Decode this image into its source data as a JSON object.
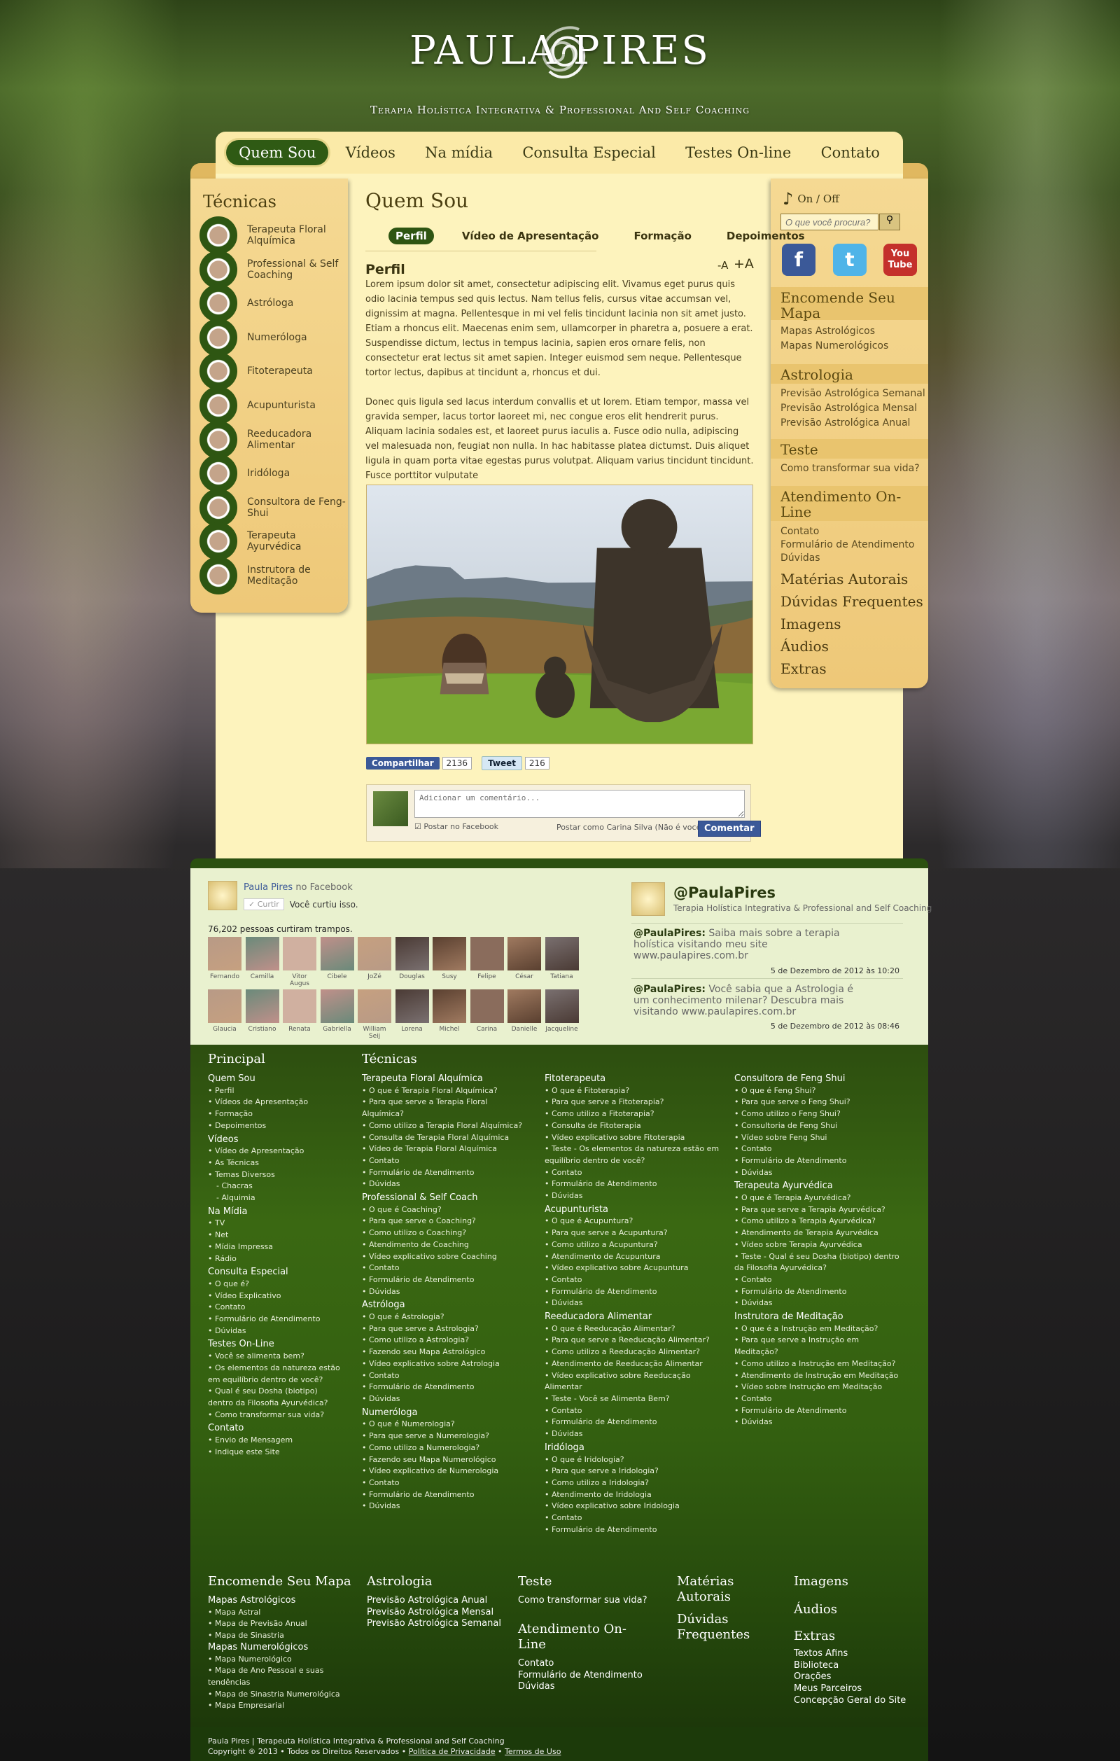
{
  "header": {
    "title": "PAULA PIRES",
    "tagline": "Terapia Holística Integrativa   &   Professional And Self Coaching"
  },
  "nav": [
    "Quem Sou",
    "Vídeos",
    "Na mídia",
    "Consulta Especial",
    "Testes On-line",
    "Contato"
  ],
  "left": {
    "title": "Técnicas",
    "items": [
      "Terapeuta Floral Alquímica",
      "Professional & Self Coaching",
      "Astróloga",
      "Numeróloga",
      "Fitoterapeuta",
      "Acupunturista",
      "Reeducadora Alimentar",
      "Iridóloga",
      "Consultora de Feng-Shui",
      "Terapeuta Ayurvédica",
      "Instrutora de Meditação"
    ]
  },
  "content": {
    "title": "Quem Sou",
    "tabs": [
      "Perfil",
      "Vídeo de Apresentação",
      "Formação",
      "Depoimentos"
    ],
    "heading": "Perfil",
    "font_minus": "-A",
    "font_plus": "+A",
    "p1": "Lorem ipsum dolor sit amet, consectetur adipiscing elit. Vivamus eget purus quis odio lacinia tempus sed quis lectus. Nam tellus felis, cursus vitae accumsan vel, dignissim at magna. Pellentesque in mi vel felis tincidunt lacinia non sit amet justo. Etiam a rhoncus elit. Maecenas enim sem, ullamcorper in pharetra a, posuere a erat. Suspendisse dictum, lectus in tempus lacinia, sapien eros ornare felis, non consectetur erat lectus sit amet sapien. Integer euismod sem neque. Pellentesque tortor lectus, dapibus at tincidunt a, rhoncus et dui.",
    "p2": "Donec quis ligula sed lacus interdum convallis et ut lorem. Etiam tempor, massa vel gravida semper, lacus tortor laoreet mi, nec congue eros elit hendrerit purus. Aliquam lacinia sodales est, et laoreet purus iaculis a. Fusce odio nulla, adipiscing vel malesuada non, feugiat non nulla. In hac habitasse platea dictumst. Duis aliquet ligula in quam porta vitae egestas purus volutpat. Aliquam varius tincidunt tincidunt. Fusce porttitor vulputate",
    "share": {
      "fb": "Compartilhar",
      "fb_count": "2136",
      "tw": "Tweet",
      "tw_count": "216"
    },
    "comment": {
      "placeholder": "Adicionar um comentário...",
      "post_fb": "Postar no Facebook",
      "post_as": "Postar como Carina Silva (Não é você?)",
      "button": "Comentar"
    }
  },
  "right": {
    "music": "On  /  Off",
    "search_placeholder": "O que você procura?",
    "social": [
      "f",
      "t",
      "You Tube"
    ],
    "s1": "Encomende Seu Mapa",
    "s1_links": [
      "Mapas Astrológicos",
      "Mapas Numerológicos"
    ],
    "s2": "Astrologia",
    "s2_links": [
      "Previsão Astrológica Semanal",
      "Previsão Astrológica Mensal",
      "Previsão Astrológica Anual"
    ],
    "s3": "Teste",
    "s3_links": [
      "Como transformar sua vida?"
    ],
    "s4": "Atendimento On-Line",
    "s4_links": [
      "Contato",
      "Formulário de Atendimento",
      "Dúvidas"
    ],
    "big": [
      "Matérias Autorais",
      "Dúvidas Frequentes",
      "Imagens",
      "Áudios",
      "Extras"
    ]
  },
  "facebook": {
    "page": "Paula Pires",
    "page_suffix": "no Facebook",
    "like_btn": "✓ Curtir",
    "liked": "Você curtiu isso.",
    "count": "76,202 pessoas curtiram trampos.",
    "faces": [
      "Fernando",
      "Camilla",
      "Vitor Augus",
      "Cibele",
      "JoZé",
      "Douglas",
      "Susy",
      "Felipe",
      "César",
      "Tatiana",
      "Glaucia",
      "Cristiano",
      "Renata",
      "Gabriella",
      "William Seij",
      "Lorena",
      "Michel",
      "Carina",
      "Danielle",
      "Jacqueline"
    ]
  },
  "twitter": {
    "handle": "@PaulaPires",
    "desc": "Terapia Holística Integrativa & Professional and Self Coaching",
    "t1_user": "@PaulaPires:",
    "t1": "Saiba mais sobre a terapia holística visitando meu site www.paulapires.com.br",
    "t1_date": "5 de Dezembro de 2012 às 10:20",
    "t2_user": "@PaulaPires:",
    "t2": "Você sabia que a Astrologia é um conhecimento milenar? Descubra mais visitando www.paulapires.com.br",
    "t2_date": "5 de Dezembro de 2012 às 08:46"
  },
  "footer": {
    "h_principal": "Principal",
    "h_tecnicas": "Técnicas",
    "principal": [
      {
        "s": "Quem Sou"
      },
      {
        "i": "Perfil"
      },
      {
        "i": "Vídeos de Apresentação"
      },
      {
        "i": "Formação"
      },
      {
        "i": "Depoimentos"
      },
      {
        "s": "Vídeos"
      },
      {
        "i": "Vídeo de Apresentação"
      },
      {
        "i": "As Técnicas"
      },
      {
        "i": "Temas Diversos"
      },
      {
        "u": "Chacras"
      },
      {
        "u": "Alquimia"
      },
      {
        "s": "Na Mídia"
      },
      {
        "i": "TV"
      },
      {
        "i": "Net"
      },
      {
        "i": "Mídia Impressa"
      },
      {
        "i": "Rádio"
      },
      {
        "s": "Consulta Especial"
      },
      {
        "i": "O que é?"
      },
      {
        "i": "Vídeo Explicativo"
      },
      {
        "i": "Contato"
      },
      {
        "i": "Formulário de Atendimento"
      },
      {
        "i": "Dúvidas"
      },
      {
        "s": "Testes On-Line"
      },
      {
        "i": "Você se alimenta bem?"
      },
      {
        "i": "Os elementos da natureza estão em equilíbrio dentro de você?"
      },
      {
        "i": "Qual é seu Dosha (biotipo) dentro da Filosofia Ayurvédica?"
      },
      {
        "i": "Como transformar sua vida?"
      },
      {
        "s": "Contato"
      },
      {
        "i": "Envio de Mensagem"
      },
      {
        "i": "Indique este Site"
      }
    ],
    "col1": [
      {
        "s": "Terapeuta Floral Alquímica"
      },
      {
        "i": "O que é Terapia Floral Alquímica?"
      },
      {
        "i": "Para que serve a Terapia Floral Alquímica?"
      },
      {
        "i": "Como utilizo a Terapia Floral Alquímica?"
      },
      {
        "i": "Consulta de Terapia Floral Alquímica"
      },
      {
        "i": "Vídeo de Terapia Floral Alquímica"
      },
      {
        "i": "Contato"
      },
      {
        "i": "Formulário de Atendimento"
      },
      {
        "i": "Dúvidas"
      },
      {
        "s": "Professional & Self Coach"
      },
      {
        "i": "O que é Coaching?"
      },
      {
        "i": "Para que serve o Coaching?"
      },
      {
        "i": "Como utilizo o Coaching?"
      },
      {
        "i": "Atendimento de Coaching"
      },
      {
        "i": "Vídeo explicativo sobre Coaching"
      },
      {
        "i": "Contato"
      },
      {
        "i": "Formulário de Atendimento"
      },
      {
        "i": "Dúvidas"
      },
      {
        "s": "Astróloga"
      },
      {
        "i": "O que é Astrologia?"
      },
      {
        "i": "Para que serve a Astrologia?"
      },
      {
        "i": "Como utilizo a Astrologia?"
      },
      {
        "i": "Fazendo seu Mapa Astrológico"
      },
      {
        "i": "Vídeo explicativo sobre Astrologia"
      },
      {
        "i": "Contato"
      },
      {
        "i": "Formulário de Atendimento"
      },
      {
        "i": "Dúvidas"
      },
      {
        "s": "Numeróloga"
      },
      {
        "i": "O que é Numerologia?"
      },
      {
        "i": "Para que serve a Numerologia?"
      },
      {
        "i": "Como utilizo a Numerologia?"
      },
      {
        "i": "Fazendo seu Mapa Numerológico"
      },
      {
        "i": "Vídeo explicativo de Numerologia"
      },
      {
        "i": "Contato"
      },
      {
        "i": "Formulário de Atendimento"
      },
      {
        "i": "Dúvidas"
      }
    ],
    "col2": [
      {
        "s": "Fitoterapeuta"
      },
      {
        "i": "O que é Fitoterapia?"
      },
      {
        "i": "Para que serve a Fitoterapia?"
      },
      {
        "i": "Como utilizo a Fitoterapia?"
      },
      {
        "i": "Consulta de Fitoterapia"
      },
      {
        "i": "Vídeo explicativo sobre Fitoterapia"
      },
      {
        "i": "Teste - Os elementos da natureza estão em equilíbrio dentro de você?"
      },
      {
        "i": "Contato"
      },
      {
        "i": "Formulário de Atendimento"
      },
      {
        "i": "Dúvidas"
      },
      {
        "s": "Acupunturista"
      },
      {
        "i": "O que é Acupuntura?"
      },
      {
        "i": "Para que serve a Acupuntura?"
      },
      {
        "i": "Como utilizo a Acupuntura?"
      },
      {
        "i": "Atendimento de Acupuntura"
      },
      {
        "i": "Vídeo explicativo sobre Acupuntura"
      },
      {
        "i": "Contato"
      },
      {
        "i": "Formulário de Atendimento"
      },
      {
        "i": "Dúvidas"
      },
      {
        "s": "Reeducadora Alimentar"
      },
      {
        "i": "O que é Reeducação Alimentar?"
      },
      {
        "i": "Para que serve a Reeducação Alimentar?"
      },
      {
        "i": "Como utilizo a Reeducação Alimentar?"
      },
      {
        "i": "Atendimento de Reeducação Alimentar"
      },
      {
        "i": "Vídeo explicativo sobre Reeducação Alimentar"
      },
      {
        "i": "Teste - Você se Alimenta Bem?"
      },
      {
        "i": "Contato"
      },
      {
        "i": "Formulário de Atendimento"
      },
      {
        "i": "Dúvidas"
      },
      {
        "s": "Iridóloga"
      },
      {
        "i": "O que é Iridologia?"
      },
      {
        "i": "Para que serve a Iridologia?"
      },
      {
        "i": "Como utilizo a Iridologia?"
      },
      {
        "i": "Atendimento de Iridologia"
      },
      {
        "i": "Vídeo explicativo sobre Iridologia"
      },
      {
        "i": "Contato"
      },
      {
        "i": "Formulário de Atendimento"
      }
    ],
    "col3": [
      {
        "s": "Consultora de Feng Shui"
      },
      {
        "i": "O que é Feng Shui?"
      },
      {
        "i": "Para que serve o Feng Shui?"
      },
      {
        "i": "Como utilizo o Feng Shui?"
      },
      {
        "i": "Consultoria de Feng Shui"
      },
      {
        "i": "Vídeo sobre Feng Shui"
      },
      {
        "i": "Contato"
      },
      {
        "i": "Formulário de Atendimento"
      },
      {
        "i": "Dúvidas"
      },
      {
        "s": "Terapeuta Ayurvédica"
      },
      {
        "i": "O que é Terapia Ayurvédica?"
      },
      {
        "i": "Para que serve a Terapia Ayurvédica?"
      },
      {
        "i": "Como utilizo a Terapia Ayurvédica?"
      },
      {
        "i": "Atendimento de Terapia Ayurvédica"
      },
      {
        "i": "Vídeo sobre Terapia Ayurvédica"
      },
      {
        "i": "Teste - Qual é seu Dosha (biotipo) dentro da Filosofia Ayurvédica?"
      },
      {
        "i": "Contato"
      },
      {
        "i": "Formulário de Atendimento"
      },
      {
        "i": "Dúvidas"
      },
      {
        "s": "Instrutora de Meditação"
      },
      {
        "i": "O que é a Instrução em Meditação?"
      },
      {
        "i": "Para que serve a Instrução em Meditação?"
      },
      {
        "i": "Como utilizo a Instrução em Meditação?"
      },
      {
        "i": "Atendimento de Instrução em Meditação"
      },
      {
        "i": "Vídeo sobre Instrução em Meditação"
      },
      {
        "i": "Contato"
      },
      {
        "i": "Formulário de Atendimento"
      },
      {
        "i": "Dúvidas"
      }
    ],
    "mapa_h": "Encomende Seu Mapa",
    "mapa": [
      {
        "b": "Mapas Astrológicos"
      },
      {
        "i": "Mapa Astral"
      },
      {
        "i": "Mapa de Previsão Anual"
      },
      {
        "i": "Mapa de Sinastria"
      },
      {
        "b": "Mapas Numerológicos"
      },
      {
        "i": "Mapa Numerológico"
      },
      {
        "i": "Mapa de Ano Pessoal e suas tendências"
      },
      {
        "i": "Mapa de Sinastria Numerológica"
      },
      {
        "i": "Mapa Empresarial"
      }
    ],
    "astro_h": "Astrologia",
    "astro": [
      {
        "b": "Previsão Astrológica Anual"
      },
      {
        "b": "Previsão Astrológica Mensal"
      },
      {
        "b": "Previsão Astrológica Semanal"
      }
    ],
    "teste_h": "Teste",
    "teste": [
      {
        "b": "Como transformar sua vida?"
      }
    ],
    "atend_h": "Atendimento On-Line",
    "atend": [
      {
        "b": "Contato"
      },
      {
        "b": "Formulário de Atendimento"
      },
      {
        "b": "Dúvidas"
      }
    ],
    "materias_h": "Matérias Autorais",
    "duvidas_h": "Dúvidas Frequentes",
    "imagens_h": "Imagens",
    "audios_h": "Áudios",
    "extras_h": "Extras",
    "extras": [
      {
        "b": "Textos Afins"
      },
      {
        "b": "Biblioteca"
      },
      {
        "b": "Orações"
      },
      {
        "b": "Meus Parceiros"
      },
      {
        "b": "Concepção Geral do Site"
      }
    ]
  },
  "bottom": {
    "line1": "Paula Pires | Terapeuta Holística Integrativa & Professional and Self Coaching",
    "line2": "Copyright ® 2013 • Todos os Direitos Reservados •",
    "privacy": "Política de Privacidade",
    "terms": "Termos de Uso"
  }
}
